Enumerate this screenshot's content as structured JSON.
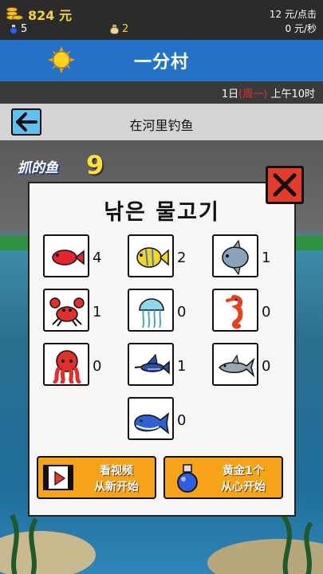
{
  "status": {
    "gold": "824 元",
    "potions": "5",
    "bags": "2",
    "rate_click": "12 元/点击",
    "rate_second": "0 元/秒"
  },
  "header": {
    "title": "一分村",
    "icon": "sun-icon"
  },
  "datebar": {
    "day": "1日",
    "weekday": "(周一)",
    "time": "上午10时"
  },
  "activity": {
    "title": "在河里钓鱼",
    "back_icon": "arrow-left-icon"
  },
  "scene": {
    "caught_label": "抓的鱼",
    "caught_count": "9"
  },
  "dialog": {
    "title": "낚은 물고기",
    "close_icon": "close-x-icon",
    "fish": [
      {
        "name": "red-fish",
        "count": "4"
      },
      {
        "name": "yellow-fish",
        "count": "2"
      },
      {
        "name": "sunfish",
        "count": "1"
      },
      {
        "name": "crab",
        "count": "1"
      },
      {
        "name": "jellyfish",
        "count": "0"
      },
      {
        "name": "seahorse",
        "count": "0"
      },
      {
        "name": "octopus",
        "count": "0"
      },
      {
        "name": "marlin",
        "count": "1"
      },
      {
        "name": "shark",
        "count": "0"
      },
      {
        "name": "whale",
        "count": "0"
      }
    ],
    "buttons": [
      {
        "line1": "看视频",
        "line2": "从新开始",
        "icon": "video-ad-icon"
      },
      {
        "line1": "黄金1个",
        "line2": "从心开始",
        "icon": "potion-icon"
      }
    ]
  },
  "colors": {
    "titlebar": "#2573c9",
    "button": "#f6a317",
    "close": "#e43b2c",
    "gold": "#f4d03f"
  }
}
